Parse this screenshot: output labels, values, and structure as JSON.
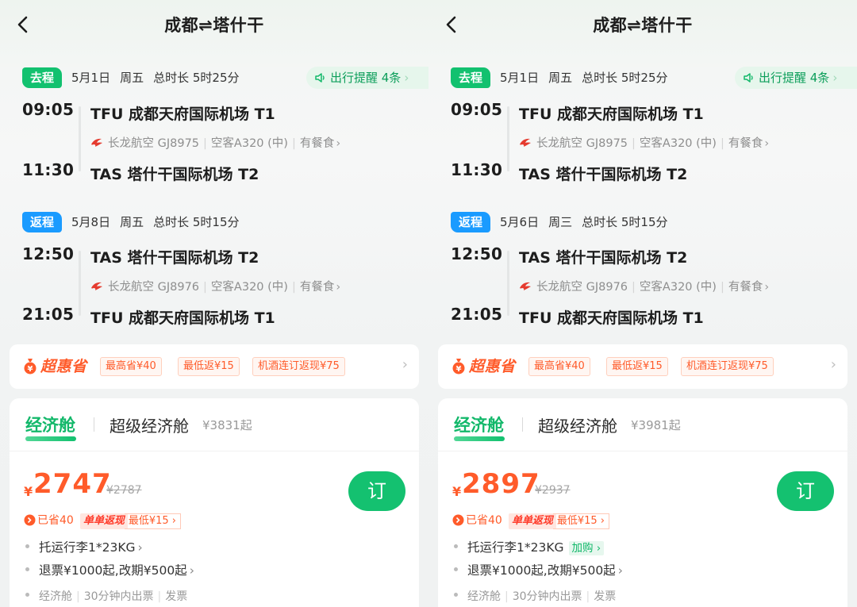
{
  "panels": [
    {
      "nav": {
        "title": "成都⇌塔什干"
      },
      "outbound": {
        "tag": "去程",
        "date": "5月1日",
        "weekday": "周五",
        "duration": "总时长 5时25分",
        "dep_time": "09:05",
        "dep_airport": "TFU 成都天府国际机场 T1",
        "airline": "长龙航空",
        "flight_no": "GJ8975",
        "aircraft": "空客A320 (中)",
        "meal": "有餐食",
        "arr_time": "11:30",
        "arr_airport": "TAS 塔什干国际机场 T2"
      },
      "reminder": {
        "label": "出行提醒 4条"
      },
      "inbound": {
        "tag": "返程",
        "date": "5月8日",
        "weekday": "周五",
        "duration": "总时长 5时15分",
        "dep_time": "12:50",
        "dep_airport": "TAS 塔什干国际机场 T2",
        "airline": "长龙航空",
        "flight_no": "GJ8976",
        "aircraft": "空客A320 (中)",
        "meal": "有餐食",
        "arr_time": "21:05",
        "arr_airport": "TFU 成都天府国际机场 T1"
      },
      "deals": {
        "brand": "超惠省",
        "chips": [
          "最高省¥40",
          "最低返¥15",
          "机酒连订返现¥75"
        ]
      },
      "cabin": {
        "active_tab": "经济舱",
        "other_tab": "超级经济舱",
        "other_from": "¥3831起",
        "currency": "¥",
        "price": "2747",
        "old_price": "¥2787",
        "book": "订",
        "saved": "已省40",
        "cashback_tag": "单单返现",
        "cashback_sub": "最低¥15",
        "baggage": "托运行李1*23KG",
        "baggage_addon": "",
        "refund": "退票¥1000起,改期¥500起",
        "info": [
          "经济舱",
          "30分钟内出票",
          "发票"
        ]
      }
    },
    {
      "nav": {
        "title": "成都⇌塔什干"
      },
      "outbound": {
        "tag": "去程",
        "date": "5月1日",
        "weekday": "周五",
        "duration": "总时长 5时25分",
        "dep_time": "09:05",
        "dep_airport": "TFU 成都天府国际机场 T1",
        "airline": "长龙航空",
        "flight_no": "GJ8975",
        "aircraft": "空客A320 (中)",
        "meal": "有餐食",
        "arr_time": "11:30",
        "arr_airport": "TAS 塔什干国际机场 T2"
      },
      "reminder": {
        "label": "出行提醒 4条"
      },
      "inbound": {
        "tag": "返程",
        "date": "5月6日",
        "weekday": "周三",
        "duration": "总时长 5时15分",
        "dep_time": "12:50",
        "dep_airport": "TAS 塔什干国际机场 T2",
        "airline": "长龙航空",
        "flight_no": "GJ8976",
        "aircraft": "空客A320 (中)",
        "meal": "有餐食",
        "arr_time": "21:05",
        "arr_airport": "TFU 成都天府国际机场 T1"
      },
      "deals": {
        "brand": "超惠省",
        "chips": [
          "最高省¥40",
          "最低返¥15",
          "机酒连订返现¥75"
        ]
      },
      "cabin": {
        "active_tab": "经济舱",
        "other_tab": "超级经济舱",
        "other_from": "¥3981起",
        "currency": "¥",
        "price": "2897",
        "old_price": "¥2937",
        "book": "订",
        "saved": "已省40",
        "cashback_tag": "单单返现",
        "cashback_sub": "最低¥15",
        "baggage": "托运行李1*23KG",
        "baggage_addon": "加购",
        "refund": "退票¥1000起,改期¥500起",
        "info": [
          "经济舱",
          "30分钟内出票",
          "发票"
        ]
      }
    }
  ],
  "colors": {
    "green": "#12c16f",
    "blue": "#1a9bff",
    "orange": "#ff5b2a"
  }
}
